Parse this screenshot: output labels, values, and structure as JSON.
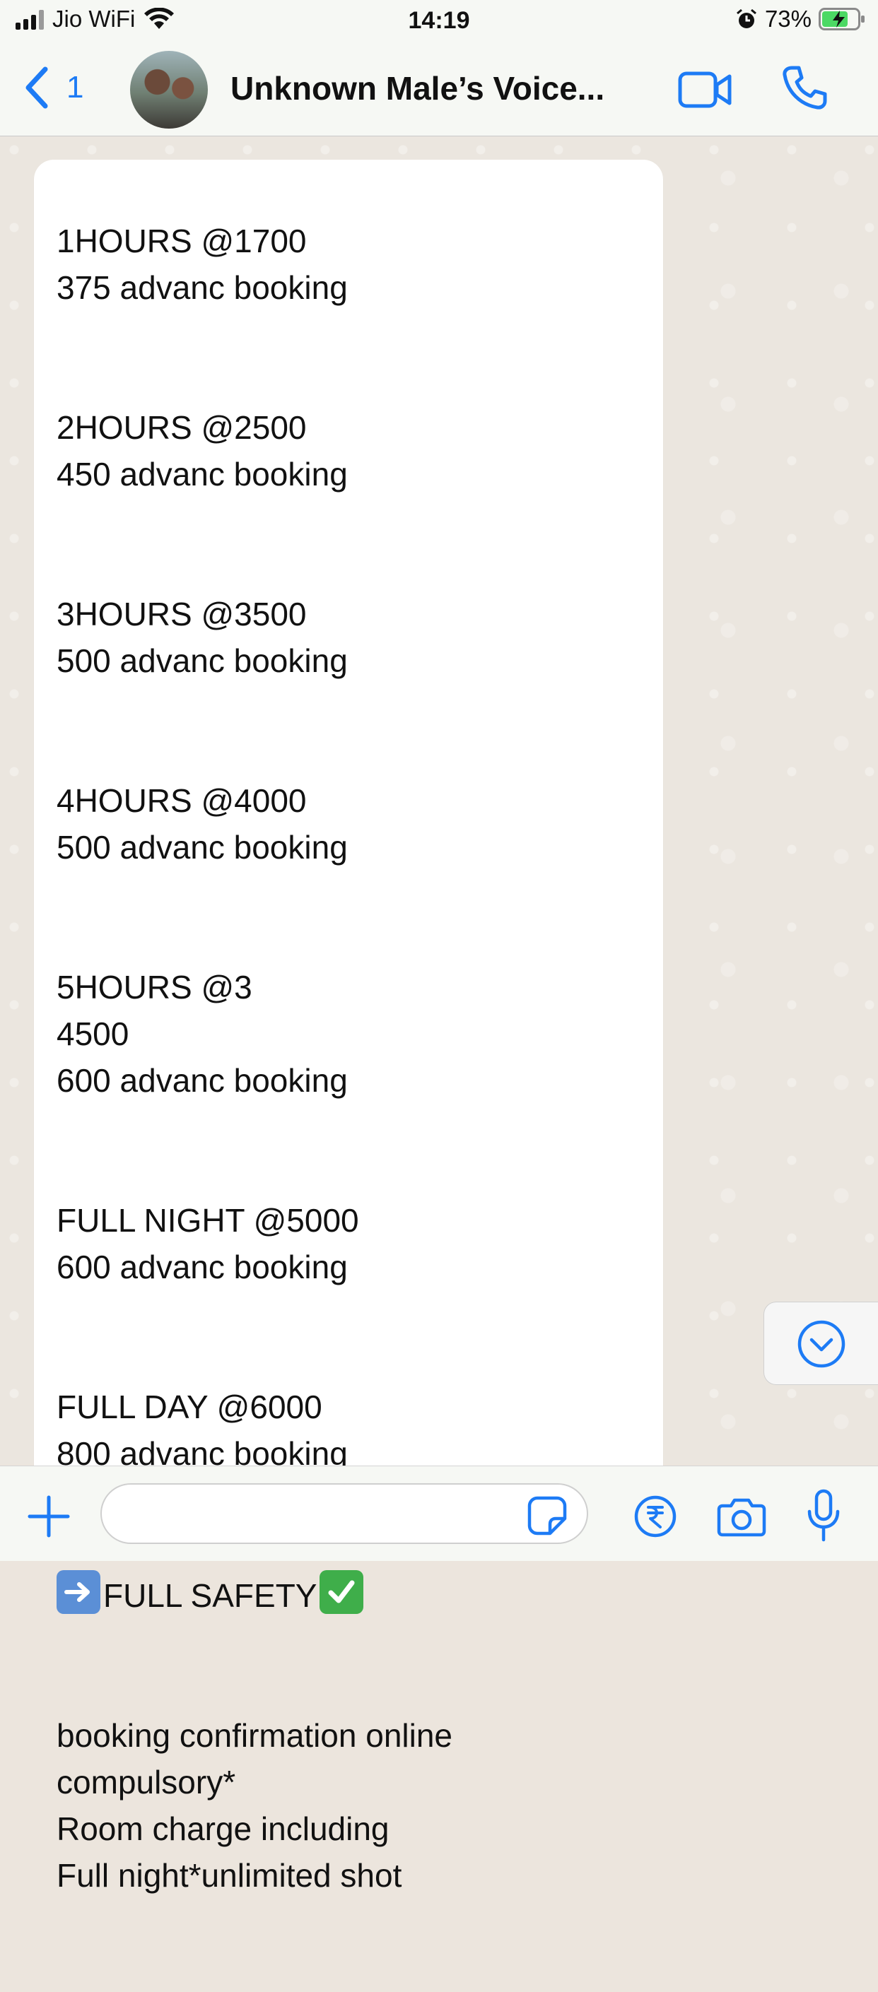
{
  "status_bar": {
    "carrier": "Jio WiFi",
    "time": "14:19",
    "battery_percent": "73%"
  },
  "header": {
    "back_count": "1",
    "contact_name": "Unknown  Male’s Voice...",
    "icons": [
      "back-chevron-icon",
      "video-call-icon",
      "phone-icon"
    ]
  },
  "message": {
    "blocks": [
      "1HOURS @1700\n375 advanc booking",
      "2HOURS @2500\n450 advanc booking",
      "3HOURS @3500\n500 advanc booking",
      "4HOURS @4000\n500 advanc booking",
      "5HOURS @3\n4500\n600 advanc booking",
      "FULL NIGHT @5000\n600 advanc booking",
      "FULL DAY @6000\n800 advanc booking"
    ],
    "safety_text": "FULL SAFETY",
    "footer": "booking confirmation online\ncompulsory*\nRoom charge including\nFull night*unlimited shot"
  },
  "input_bar": {
    "placeholder": "",
    "icons": [
      "plus-icon",
      "sticker-icon",
      "rupee-payment-icon",
      "camera-icon",
      "microphone-icon"
    ]
  },
  "colors": {
    "accent": "#1d7bf5",
    "bubble": "#ffffff",
    "wallpaper": "#ebe6df",
    "bar": "#f6f8f4"
  }
}
